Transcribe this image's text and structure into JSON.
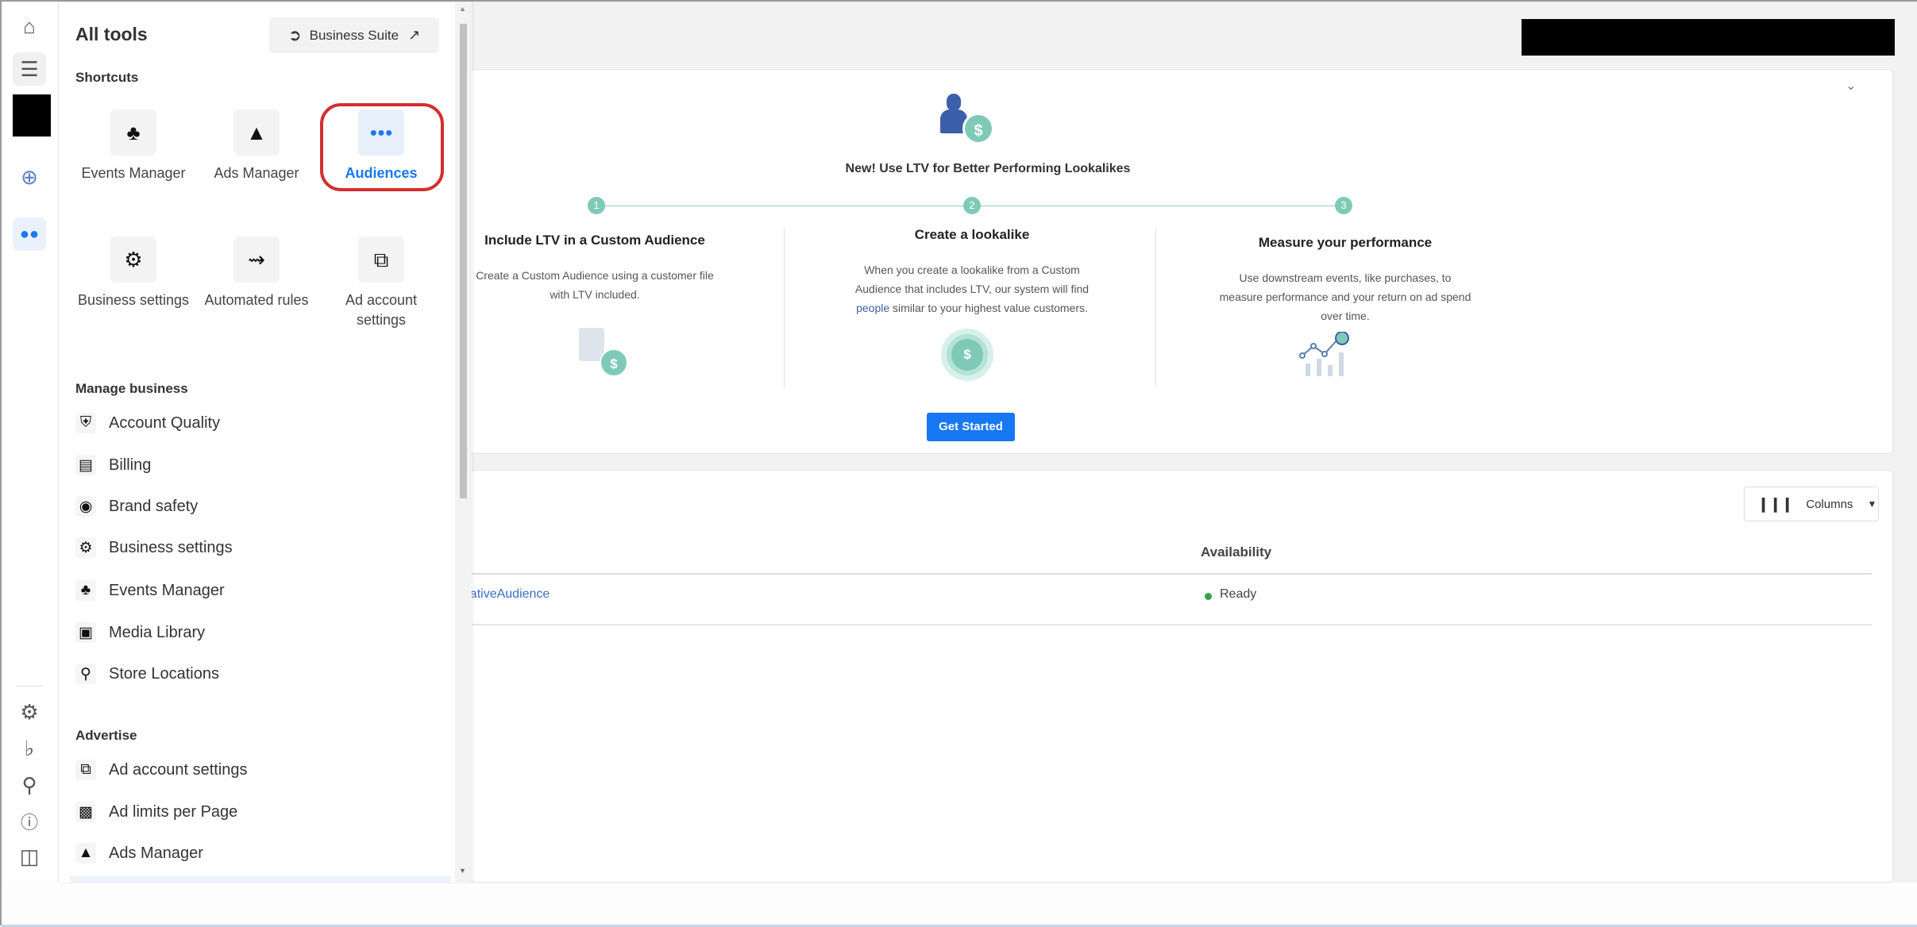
{
  "rail": {
    "icons": [
      "home-icon",
      "menu-icon",
      "plus-circle-icon",
      "audiences-icon",
      "gear-icon",
      "bell-icon",
      "search-icon",
      "help-icon",
      "panel-toggle-icon"
    ]
  },
  "panel": {
    "title": "All tools",
    "business_suite": "Business Suite",
    "shortcuts_label": "Shortcuts",
    "shortcuts": [
      {
        "label": "Events Manager",
        "icon": "events-manager-icon"
      },
      {
        "label": "Ads Manager",
        "icon": "ads-manager-icon"
      },
      {
        "label": "Audiences",
        "icon": "audiences-icon",
        "active": true
      },
      {
        "label": "Business settings",
        "icon": "gear-icon"
      },
      {
        "label": "Automated rules",
        "icon": "automated-rules-icon"
      },
      {
        "label": "Ad account settings",
        "icon": "ad-account-icon"
      }
    ],
    "manage_label": "Manage business",
    "manage": [
      {
        "label": "Account Quality",
        "icon": "account-quality-icon"
      },
      {
        "label": "Billing",
        "icon": "billing-icon"
      },
      {
        "label": "Brand safety",
        "icon": "shield-icon"
      },
      {
        "label": "Business settings",
        "icon": "gear-icon"
      },
      {
        "label": "Events Manager",
        "icon": "events-manager-icon"
      },
      {
        "label": "Media Library",
        "icon": "media-library-icon"
      },
      {
        "label": "Store Locations",
        "icon": "location-icon"
      }
    ],
    "advertise_label": "Advertise",
    "advertise": [
      {
        "label": "Ad account settings",
        "icon": "ad-account-icon"
      },
      {
        "label": "Ad limits per Page",
        "icon": "ad-limits-icon"
      },
      {
        "label": "Ads Manager",
        "icon": "ads-manager-icon"
      }
    ]
  },
  "promo": {
    "title": "New! Use LTV for Better Performing Lookalikes",
    "steps": [
      {
        "num": "1",
        "heading": "Include LTV in a Custom Audience",
        "text": "Create a Custom Audience using a customer file with LTV included."
      },
      {
        "num": "2",
        "heading": "Create a lookalike",
        "text_before": "When you create a lookalike from a Custom Audience that includes LTV, our system will find ",
        "link": "people",
        "text_after": " similar to your highest value customers."
      },
      {
        "num": "3",
        "heading": "Measure your performance",
        "text": "Use downstream events, like purchases, to measure performance and your return on ad spend over time."
      }
    ],
    "button": "Get Started"
  },
  "table": {
    "columns_button": "Columns",
    "headers": {
      "availability": "Availability"
    },
    "rows": [
      {
        "name": "egativeAudience",
        "availability": "Ready"
      }
    ]
  },
  "colors": {
    "accent": "#1877f2",
    "teal": "#7fcab7",
    "ready": "#31a24c",
    "highlight": "#d32f2f"
  }
}
